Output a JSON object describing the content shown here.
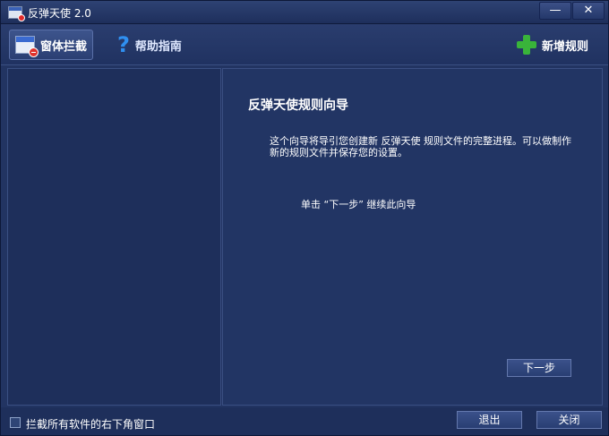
{
  "window": {
    "title": "反弹天使 2.0",
    "min_label": "—",
    "close_label": "✕"
  },
  "toolbar": {
    "block_label": "窗体拦截",
    "help_label": "帮助指南",
    "help_icon_glyph": "?",
    "add_rule_label": "新增规则"
  },
  "wizard": {
    "title": "反弹天使规则向导",
    "description": "这个向导将导引您创建新 反弹天使 规则文件的完整进程。可以做制作新的规则文件并保存您的设置。",
    "hint": "单击 “下一步” 继续此向导",
    "next_label": "下一步"
  },
  "footer": {
    "checkbox_label": "拦截所有软件的右下角窗口",
    "exit_label": "退出",
    "close_label": "关闭"
  },
  "colors": {
    "background": "#223462",
    "accent_green": "#39b43a",
    "help_blue": "#2f8ff0",
    "stop_red": "#e0322c"
  }
}
